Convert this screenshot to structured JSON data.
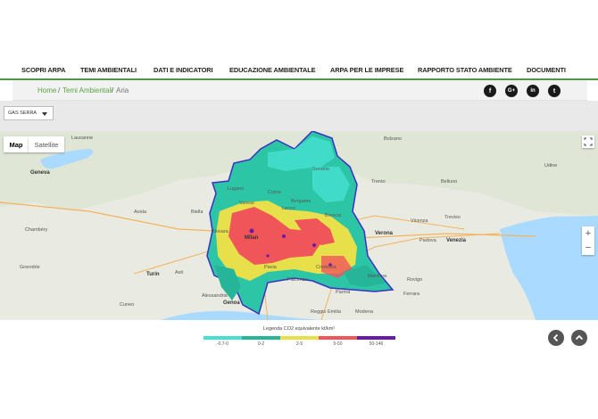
{
  "nav": {
    "items": [
      "SCOPRI ARPA",
      "TEMI AMBIENTALI",
      "DATI E INDICATORI",
      "EDUCAZIONE AMBIENTALE",
      "ARPA PER LE IMPRESE",
      "RAPPORTO STATO AMBIENTE",
      "DOCUMENTI"
    ]
  },
  "breadcrumb": {
    "home": "Home",
    "sep": "/",
    "section": "Temi Ambientali",
    "current": "Aria"
  },
  "social": {
    "facebook": "f",
    "googleplus": "G+",
    "linkedin": "in",
    "twitter": "t"
  },
  "filter": {
    "selected": "GAS SERRA"
  },
  "map": {
    "type_map": "Map",
    "type_satellite": "Satellite",
    "zoom_in": "+",
    "zoom_out": "−",
    "cities": [
      "Lausanne",
      "Geneva",
      "Chambéry",
      "Grenoble",
      "Turin",
      "Milan",
      "Bergamo",
      "Brescia",
      "Verona",
      "Trento",
      "Bolzano",
      "Venezia",
      "Padova",
      "Vicenza",
      "Treviso",
      "Genoa",
      "Parma",
      "Modena",
      "Mantova",
      "Reggio Emilia",
      "Ferrara",
      "Lugano",
      "Como",
      "Aosta",
      "Novara",
      "Alessandria",
      "Cuneo",
      "Pavia",
      "Piacenza",
      "Cremona",
      "Sondrio",
      "Udine",
      "Rovigo",
      "Asti",
      "Biella",
      "Varese",
      "Lecco",
      "Belluno"
    ]
  },
  "legend": {
    "title": "Legenda CO2 equivalente kt/km²",
    "classes": [
      {
        "label": "-0.7-0",
        "color": "#46e0d2"
      },
      {
        "label": "0-2",
        "color": "#27b59a"
      },
      {
        "label": "2-5",
        "color": "#e8e04a"
      },
      {
        "label": "5-50",
        "color": "#f0555a"
      },
      {
        "label": "50-146",
        "color": "#6a1ba0"
      }
    ]
  },
  "colors": {
    "accent_green": "#4a9a45",
    "link_green": "#5aa542"
  }
}
